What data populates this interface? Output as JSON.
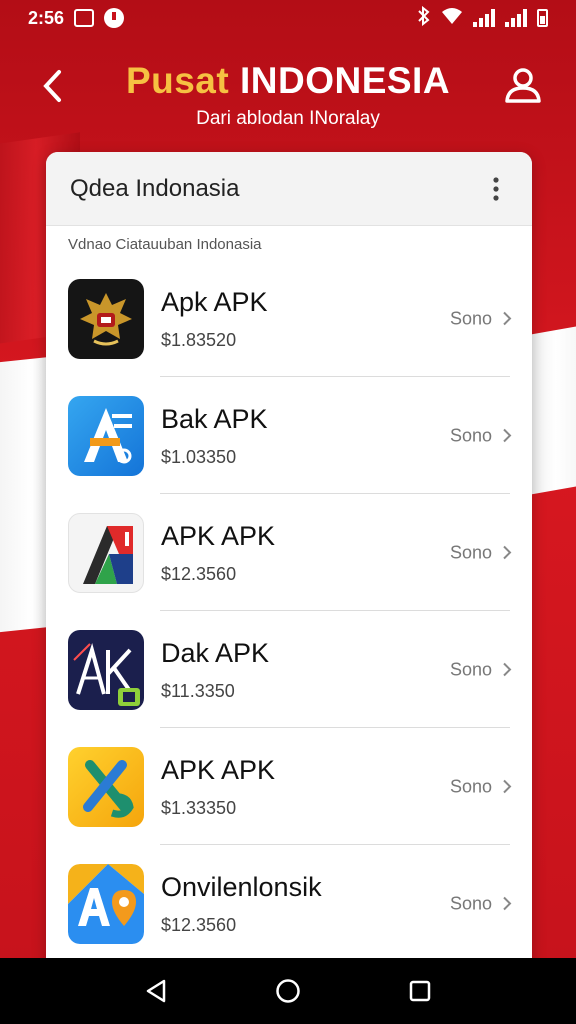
{
  "status_bar": {
    "time": "2:56"
  },
  "header": {
    "title_part1": "Pusat",
    "title_part2": "INDONESIA",
    "subtitle": "Dari ablodan INoralay"
  },
  "card": {
    "title": "Qdea Indonasia",
    "section_label": "Vdnao Ciatauuban Indonasia"
  },
  "items": [
    {
      "name": "Apk APK",
      "price": "$1.83520",
      "meta": "Sono",
      "icon": "garuda-emblem-icon"
    },
    {
      "name": "Bak APK",
      "price": "$1.03350",
      "meta": "Sono",
      "icon": "a-tools-icon"
    },
    {
      "name": "APK APK",
      "price": "$12.3560",
      "meta": "Sono",
      "icon": "a-red-icon"
    },
    {
      "name": "Dak APK",
      "price": "$11.3350",
      "meta": "Sono",
      "icon": "ak-icon"
    },
    {
      "name": "APK APK",
      "price": "$1.33350",
      "meta": "Sono",
      "icon": "x-arrow-icon"
    },
    {
      "name": "Onvilenlonsik",
      "price": "$12.3560",
      "meta": "Sono",
      "icon": "ap-map-icon"
    }
  ],
  "colors": {
    "background_red": "#c8101a",
    "title_accent": "#f6c142",
    "card_bg": "#ffffff"
  }
}
